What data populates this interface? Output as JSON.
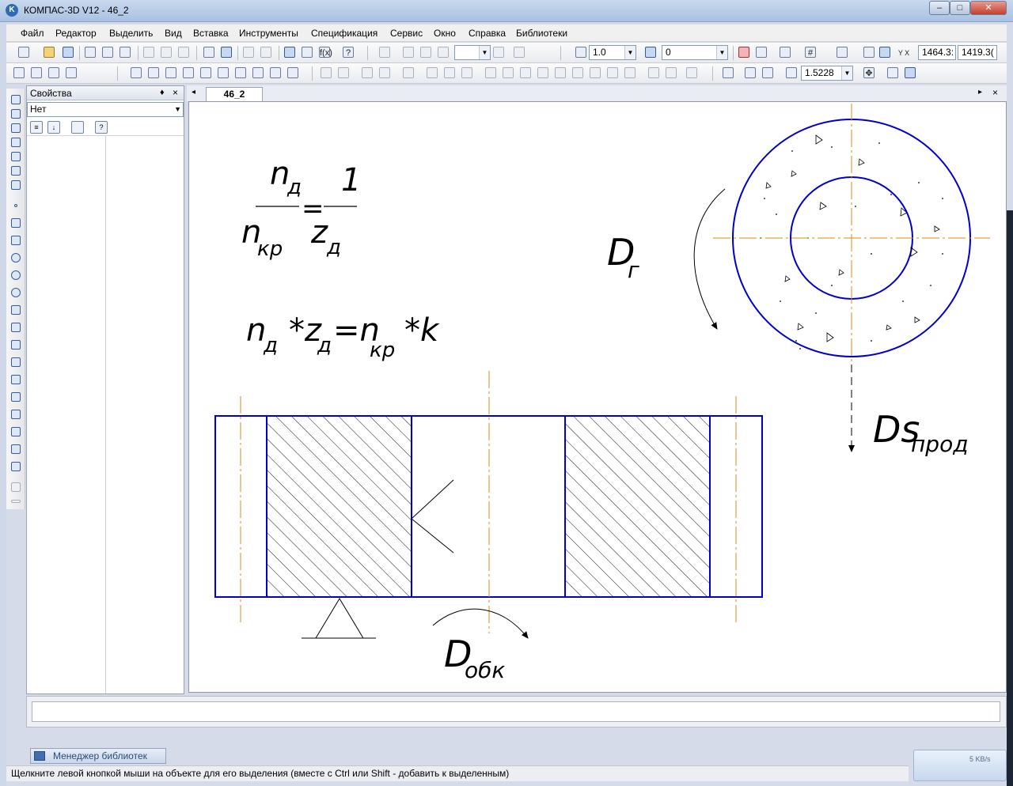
{
  "window": {
    "title": "КОМПАС-3D V12 - 46_2",
    "logo_letter": "K",
    "minimize": "–",
    "maximize": "□",
    "close": "✕"
  },
  "menu": [
    "Файл",
    "Редактор",
    "Выделить",
    "Вид",
    "Вставка",
    "Инструменты",
    "Спецификация",
    "Сервис",
    "Окно",
    "Справка",
    "Библиотеки"
  ],
  "toolbar1": {
    "line_scale": "1.0",
    "layer": "0",
    "coord_x": "1464.3:",
    "coord_y": "1419.3("
  },
  "toolbar2": {
    "zoom": "1.5228"
  },
  "properties": {
    "title": "Свойства",
    "pin": "♦",
    "close": "×",
    "selected": "Нет"
  },
  "document": {
    "tab": "46_2",
    "nav_left": "◂",
    "nav_right": "▸",
    "close": "×"
  },
  "drawing": {
    "frac_numerator": "n",
    "frac_numerator_sub": "д",
    "frac_denominator": "n",
    "frac_denominator_sub": "кр",
    "equals": "=",
    "rhs_numerator": "1",
    "rhs_denominator": "z",
    "rhs_denominator_sub": "д",
    "eq2_n": "n",
    "eq2_n_sub": "д",
    "eq2_mul1": "*z",
    "eq2_z_sub": "д",
    "eq2_eq": "=n",
    "eq2_nkr_sub": "кр",
    "eq2_mul2": "*k",
    "label_dg": "D",
    "label_dg_sub": "г",
    "label_ds": "Ds",
    "label_ds_sub": "прод",
    "label_dobk": "D",
    "label_dobk_sub": "обк"
  },
  "libraries_tab": "Менеджер библиотек",
  "status": "Щелкните левой кнопкой мыши на объекте для его выделения (вместе с Ctrl или Shift - добавить к выделенным)",
  "network": "5 KB/s",
  "colors": {
    "contour": "#0000cc",
    "axis": "#d98a1a",
    "hatch": "#000000"
  }
}
